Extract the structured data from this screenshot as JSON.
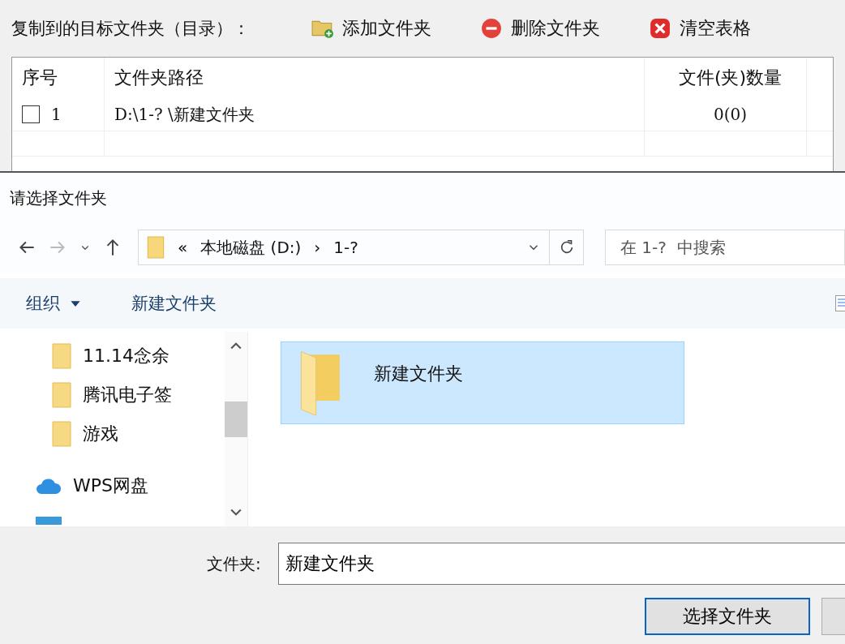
{
  "toolbar": {
    "label": "复制到的目标文件夹（目录）：",
    "actions": [
      {
        "kind": "add",
        "label": "添加文件夹"
      },
      {
        "kind": "remove",
        "label": "删除文件夹"
      },
      {
        "kind": "clear",
        "label": "清空表格"
      }
    ]
  },
  "table": {
    "columns": [
      "序号",
      "文件夹路径",
      "文件(夹)数量"
    ],
    "rows": [
      {
        "index": "1",
        "checked": false,
        "path": "D:\\1-? \\新建文件夹",
        "count": "0(0)"
      }
    ]
  },
  "dialog": {
    "title": "请选择文件夹",
    "breadcrumb": [
      "«",
      "本地磁盘 (D:)",
      "›",
      "1-?"
    ],
    "search": {
      "placeholder": "在 1-?  中搜索"
    },
    "commands": [
      {
        "kind": "menu",
        "label": "组织"
      },
      {
        "kind": "plain",
        "label": "新建文件夹"
      }
    ],
    "nav_items": [
      {
        "kind": "folder",
        "label": "11.14念余"
      },
      {
        "kind": "folder",
        "label": "腾讯电子签"
      },
      {
        "kind": "folder",
        "label": "游戏"
      },
      {
        "kind": "cloud",
        "label": "WPS网盘"
      },
      {
        "kind": "pc"
      }
    ],
    "files": [
      {
        "name": "新建文件夹",
        "selected": true
      }
    ],
    "folder_field": {
      "label": "文件夹:",
      "value": "新建文件夹"
    },
    "buttons": [
      {
        "kind": "primary",
        "label": "选择文件夹"
      },
      {
        "kind": "cut"
      }
    ]
  }
}
